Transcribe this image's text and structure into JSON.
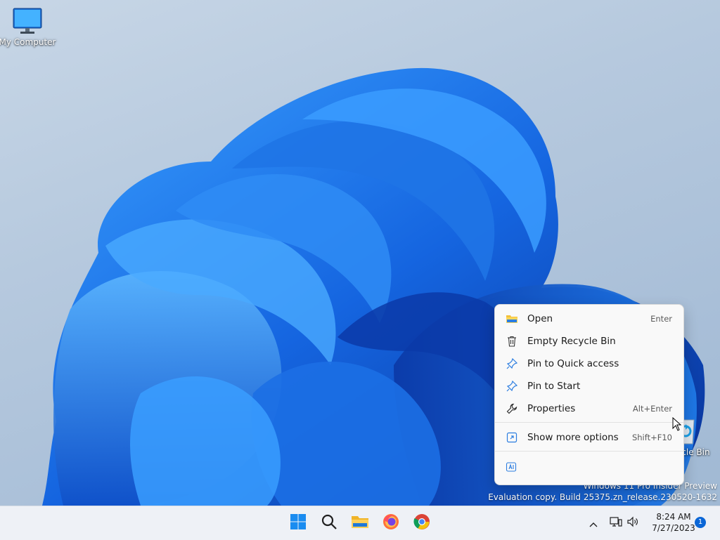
{
  "desktop": {
    "icons": [
      {
        "label": "My Computer"
      },
      {
        "label": "Recycle Bin"
      }
    ],
    "watermark": {
      "line1": "Windows 11 Pro Insider Preview",
      "line2": "Evaluation copy. Build 25375.zn_release.230520-1632"
    }
  },
  "context_menu": {
    "items": [
      {
        "label": "Open",
        "shortcut": "Enter",
        "icon": "folder-icon"
      },
      {
        "label": "Empty Recycle Bin",
        "shortcut": "",
        "icon": "trash-icon"
      },
      {
        "label": "Pin to Quick access",
        "shortcut": "",
        "icon": "pin-icon"
      },
      {
        "label": "Pin to Start",
        "shortcut": "",
        "icon": "pin-icon"
      },
      {
        "label": "Properties",
        "shortcut": "Alt+Enter",
        "icon": "wrench-icon"
      },
      {
        "label": "Show more options",
        "shortcut": "Shift+F10",
        "icon": "expand-icon"
      }
    ],
    "bottom_icon": "translate-icon"
  },
  "taskbar": {
    "apps": [
      "start-icon",
      "search-icon",
      "file-explorer-icon",
      "firefox-icon",
      "chrome-icon"
    ],
    "tray_icons": [
      "chevron-up-icon",
      "network-icon",
      "volume-icon"
    ],
    "time": "8:24 AM",
    "date": "7/27/2023",
    "notification_count": "1"
  },
  "colors": {
    "accent": "#0a66d6",
    "bloom_dark": "#0b3fb8",
    "bloom_light": "#2b8df0"
  }
}
